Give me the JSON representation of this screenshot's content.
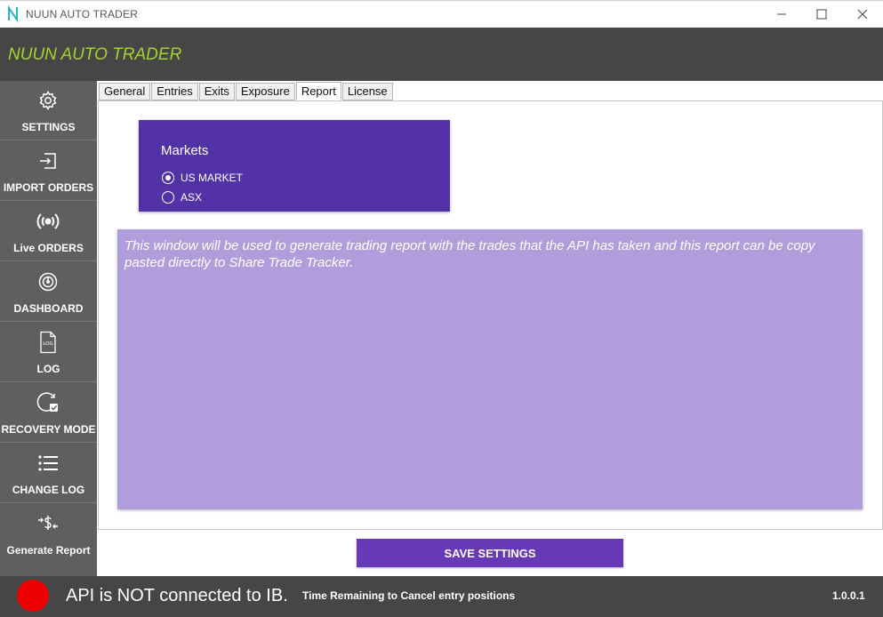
{
  "window": {
    "title": "NUUN AUTO TRADER"
  },
  "header": {
    "app_title": "NUUN AUTO TRADER",
    "accent_color": "#a6d22e"
  },
  "sidebar": {
    "items": [
      {
        "label": "SETTINGS",
        "icon": "gear-icon"
      },
      {
        "label": "IMPORT ORDERS",
        "icon": "import-icon"
      },
      {
        "label": "Live ORDERS",
        "icon": "broadcast-icon"
      },
      {
        "label": "DASHBOARD",
        "icon": "dashboard-icon"
      },
      {
        "label": "LOG",
        "icon": "log-file-icon"
      },
      {
        "label": "RECOVERY MODE",
        "icon": "recovery-icon"
      },
      {
        "label": "CHANGE LOG",
        "icon": "list-icon"
      },
      {
        "label": "Generate Report",
        "icon": "dollar-exchange-icon"
      }
    ]
  },
  "tabs": [
    {
      "label": "General",
      "active": false
    },
    {
      "label": "Entries",
      "active": false
    },
    {
      "label": "Exits",
      "active": false
    },
    {
      "label": "Exposure",
      "active": false
    },
    {
      "label": "Report",
      "active": true
    },
    {
      "label": "License",
      "active": false
    }
  ],
  "markets": {
    "title": "Markets",
    "options": [
      {
        "label": "US MARKET",
        "selected": true
      },
      {
        "label": "ASX",
        "selected": false
      }
    ],
    "color": "#5332a8"
  },
  "report": {
    "text": "This window will be used to generate trading report with the trades that the API has taken and this report can be copy pasted directly to Share Trade Tracker.",
    "color": "#b19ddb"
  },
  "save_button": {
    "label": "SAVE SETTINGS",
    "color": "#6839b6"
  },
  "status": {
    "indicator_color": "#ee0000",
    "connection": "API is NOT connected to IB.",
    "time_remaining": "Time Remaining to Cancel entry positions",
    "version": "1.0.0.1"
  }
}
